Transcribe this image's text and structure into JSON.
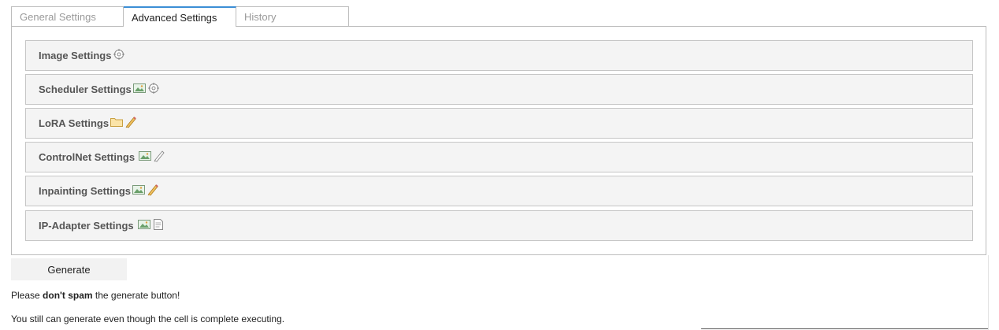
{
  "tabs": [
    {
      "label": "General Settings",
      "active": false
    },
    {
      "label": "Advanced Settings",
      "active": true
    },
    {
      "label": "History",
      "active": false
    }
  ],
  "sections": [
    {
      "label": "Image Settings",
      "icons": [
        "gear-icon"
      ]
    },
    {
      "label": "Scheduler Settings",
      "icons": [
        "image-icon",
        "gear-icon"
      ]
    },
    {
      "label": "LoRA Settings",
      "icons": [
        "folder-icon",
        "pencil-icon"
      ]
    },
    {
      "label": "ControlNet Settings",
      "icons": [
        "image-icon",
        "pencil-icon"
      ]
    },
    {
      "label": "Inpainting Settings",
      "icons": [
        "image-icon",
        "pencil-icon"
      ]
    },
    {
      "label": "IP-Adapter Settings",
      "icons": [
        "image-icon",
        "document-icon"
      ]
    }
  ],
  "generate_button": "Generate",
  "notice": {
    "prefix": "Please ",
    "bold": "don't spam",
    "suffix": " the generate button!"
  },
  "info": "You still can generate even though the cell is complete executing.",
  "colors": {
    "active_tab_accent": "#3c8fd6",
    "section_bg": "#f4f4f4"
  }
}
